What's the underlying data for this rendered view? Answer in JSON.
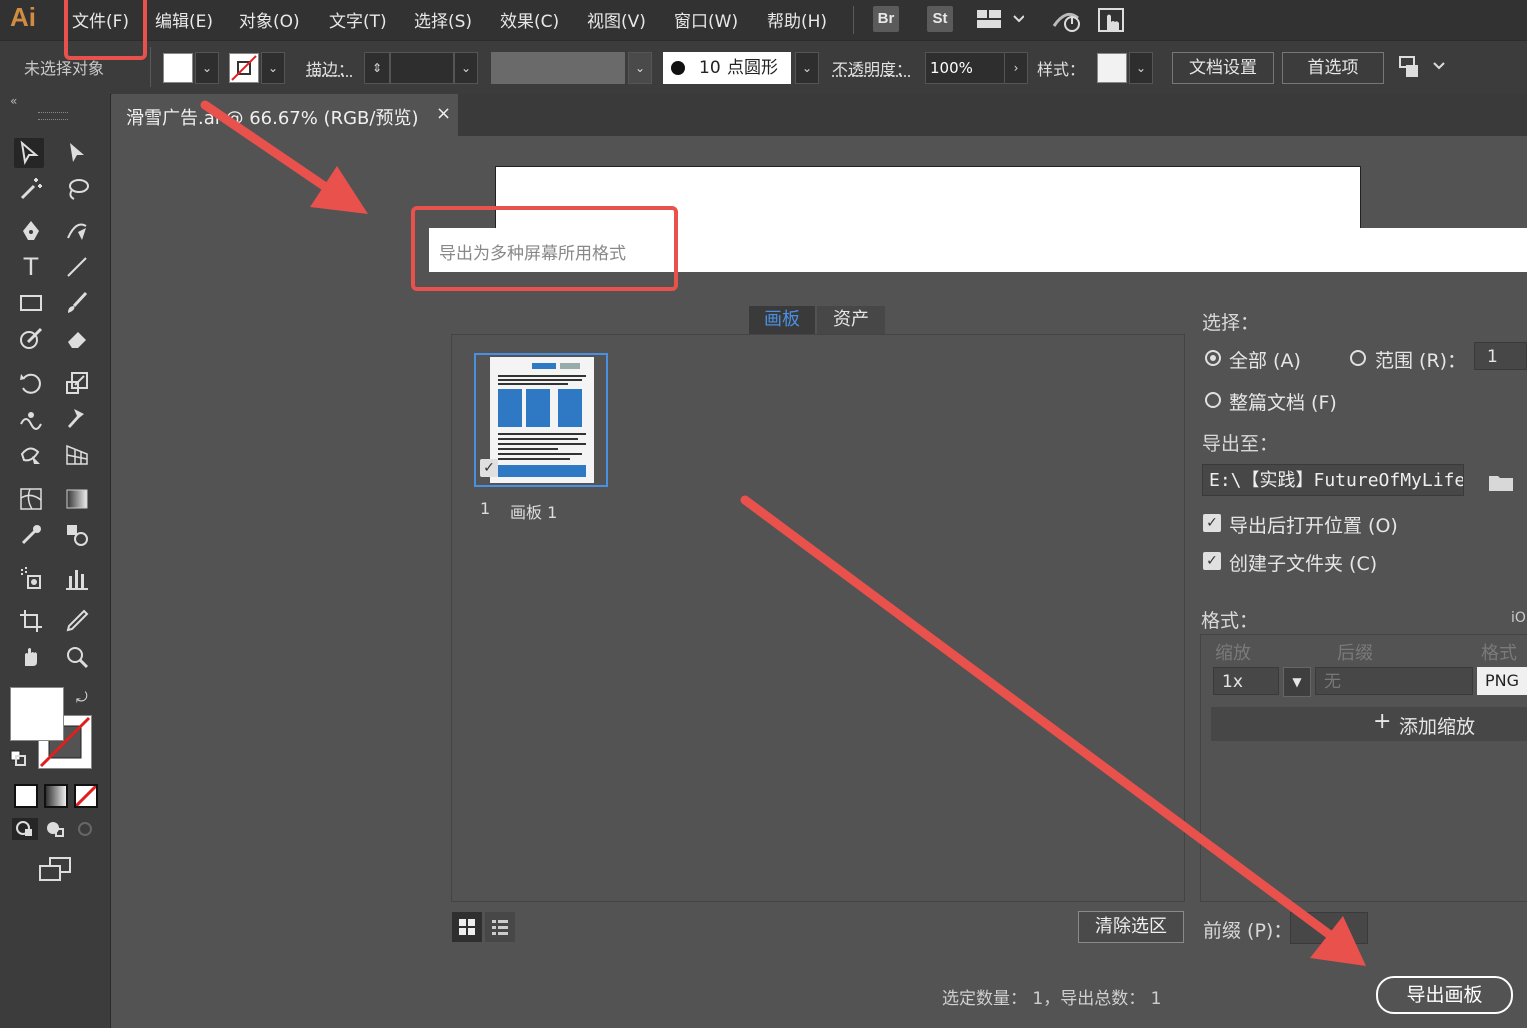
{
  "app": {
    "logo": "Ai"
  },
  "menubar": {
    "items": [
      "文件(F)",
      "编辑(E)",
      "对象(O)",
      "文字(T)",
      "选择(S)",
      "效果(C)",
      "视图(V)",
      "窗口(W)",
      "帮助(H)"
    ],
    "bridge_labels": [
      "Br",
      "St"
    ]
  },
  "controlbar": {
    "selection_status": "未选择对象",
    "stroke_label": "描边：",
    "brush_size": "10",
    "brush_label": "点圆形",
    "opacity_label": "不透明度：",
    "opacity_value": "100%",
    "style_label": "样式：",
    "doc_setup_button": "文档设置",
    "preferences_button": "首选项"
  },
  "document_tab": {
    "title": "滑雪广告.ai @ 66.67% (RGB/预览)",
    "close": "×"
  },
  "dialog": {
    "title": "导出为多种屏幕所用格式",
    "tabs": [
      {
        "label": "画板",
        "active": true
      },
      {
        "label": "资产",
        "active": false
      }
    ],
    "artboard": {
      "number": "1",
      "name": "画板 1"
    },
    "select_label": "选择：",
    "select_options": {
      "all": "全部 (A)",
      "range": "范围 (R)：",
      "range_value": "1",
      "whole_doc": "整篇文档 (F)"
    },
    "export_to_label": "导出至：",
    "export_path": "E:\\【实践】FutureOfMyLife",
    "open_after_export": "导出后打开位置 (O)",
    "create_subfolder": "创建子文件夹 (C)",
    "format_label": "格式：",
    "format_side_label": "iO",
    "format_columns": [
      "缩放",
      "后缀",
      "格式"
    ],
    "format_row": {
      "scale": "1x",
      "suffix_placeholder": "无",
      "format": "PNG"
    },
    "add_scale_button": "添加缩放",
    "clear_selection_button": "清除选区",
    "prefix_label": "前缀 (P)：",
    "status_text": "选定数量： 1，导出总数： 1",
    "export_button": "导出画板"
  },
  "colors": {
    "menubar_bg": "#323232",
    "panel_bg": "#3c3c3c",
    "workspace_bg": "#535353",
    "annotation_red": "#e8514c",
    "selection_blue": "#4a90e2",
    "active_tab_text": "#4a90e2",
    "logo_orange": "#d28c42"
  }
}
